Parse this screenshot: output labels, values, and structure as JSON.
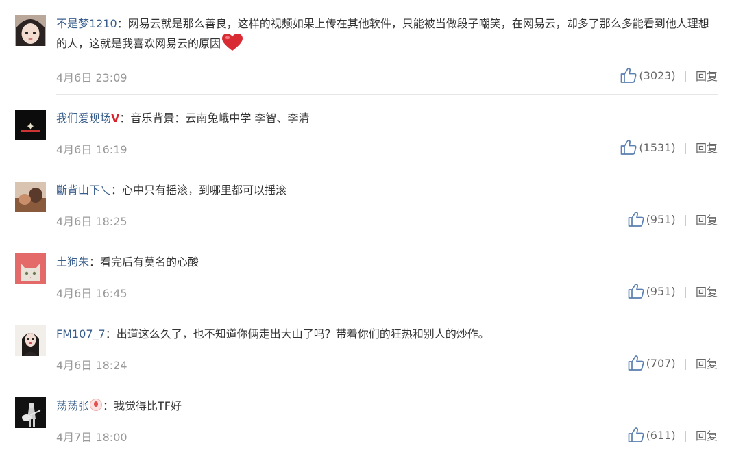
{
  "comments": [
    {
      "username": "不是梦1210",
      "badge": "",
      "text": "网易云就是那么善良，这样的视频如果上传在其他软件，只能被当做段子嘲笑，在网易云，却多了那么多能看到他人理想的人，这就是我喜欢网易云的原因",
      "date": "4月6日 23:09",
      "likes": "(3023)",
      "reply": "回复",
      "has_heart": true
    },
    {
      "username": "我们爱现场",
      "badge": "V",
      "text": "音乐背景：云南兔峨中学 李智、李清",
      "date": "4月6日 16:19",
      "likes": "(1531)",
      "reply": "回复",
      "has_heart": false
    },
    {
      "username": "斷背山下乀",
      "badge": "",
      "text": "心中只有摇滚，到哪里都可以摇滚",
      "date": "4月6日 18:25",
      "likes": "(951)",
      "reply": "回复",
      "has_heart": false
    },
    {
      "username": "土狗朱",
      "badge": "",
      "text": "看完后有莫名的心酸",
      "date": "4月6日 16:45",
      "likes": "(951)",
      "reply": "回复",
      "has_heart": false
    },
    {
      "username": "FM107_7",
      "badge": "",
      "text": "出道这么久了，也不知道你俩走出大山了吗？带着你们的狂热和别人的炒作。",
      "date": "4月6日 18:24",
      "likes": "(707)",
      "reply": "回复",
      "has_heart": false
    },
    {
      "username": "荡荡张",
      "badge": "",
      "text": "我觉得比TF好",
      "date": "4月7日 18:00",
      "likes": "(611)",
      "reply": "回复",
      "has_heart": false
    }
  ],
  "colors": {
    "username": "#3a5e8c",
    "body_text": "#333333",
    "meta_text": "#999999",
    "badge": "#d6232c",
    "like_icon": "#5a7fb0",
    "divider": "#e6e6e6"
  },
  "icons": {
    "like": "thumbs-up-icon",
    "heart": "heart-emoji-icon",
    "separator": "|",
    "colon": "："
  }
}
